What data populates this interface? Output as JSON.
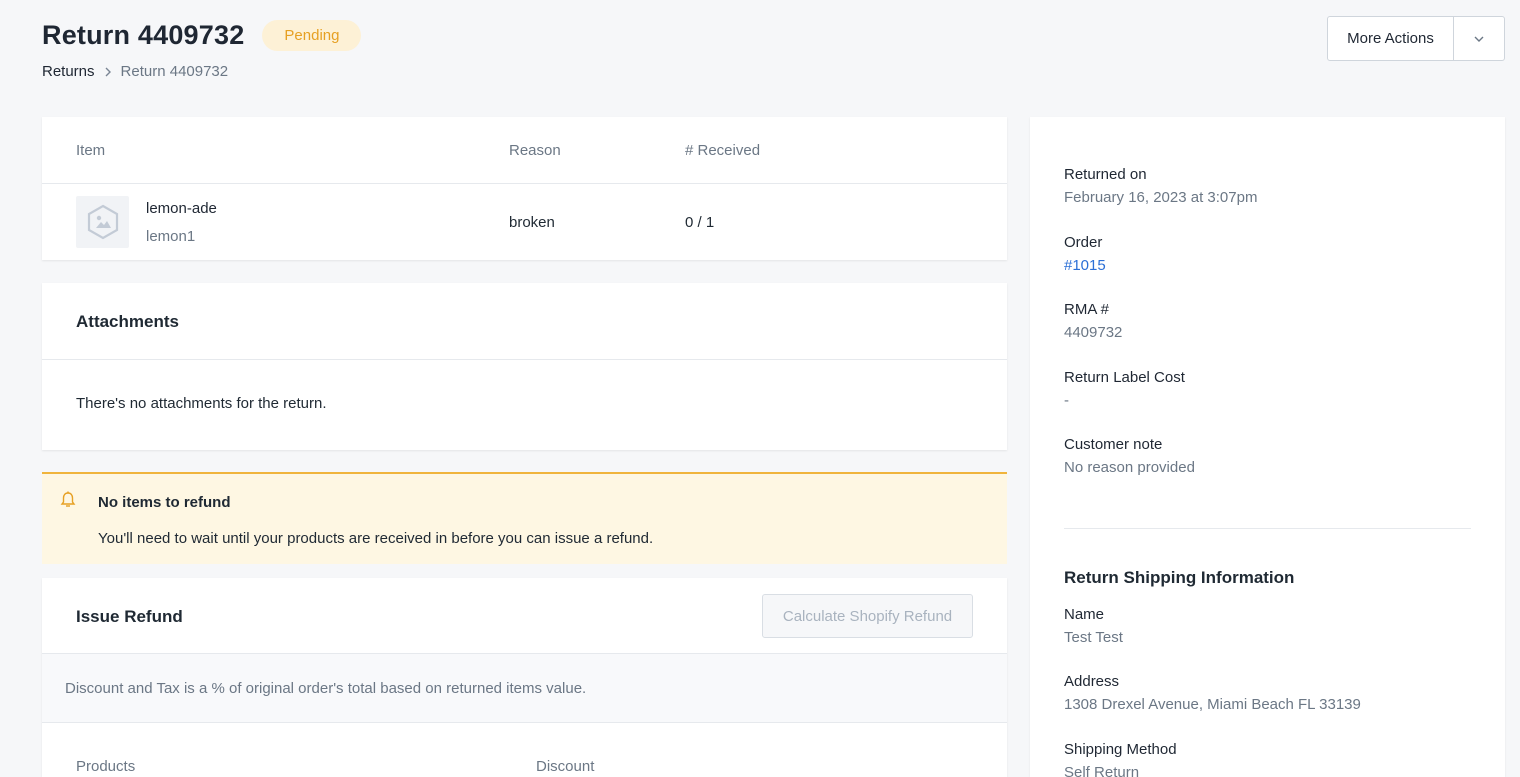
{
  "header": {
    "title": "Return 4409732",
    "status": "Pending",
    "breadcrumb": {
      "parent": "Returns",
      "current": "Return 4409732"
    },
    "more_actions": "More Actions"
  },
  "items": {
    "columns": {
      "item": "Item",
      "reason": "Reason",
      "received": "# Received"
    },
    "rows": [
      {
        "name": "lemon-ade",
        "sku": "lemon1",
        "reason": "broken",
        "received": "0 / 1"
      }
    ]
  },
  "attachments": {
    "title": "Attachments",
    "empty_text": "There's no attachments for the return."
  },
  "alert": {
    "title": "No items to refund",
    "text": "You'll need to wait until your products are received in before you can issue a refund."
  },
  "refund": {
    "title": "Issue Refund",
    "calc_button": "Calculate Shopify Refund",
    "note": "Discount and Tax is a % of original order's total based on returned items value.",
    "columns": {
      "products": "Products",
      "discount": "Discount"
    }
  },
  "details": {
    "returned_on": {
      "label": "Returned on",
      "value": "February 16, 2023 at 3:07pm"
    },
    "order": {
      "label": "Order",
      "value": "#1015"
    },
    "rma": {
      "label": "RMA #",
      "value": "4409732"
    },
    "label_cost": {
      "label": "Return Label Cost",
      "value": "-"
    },
    "customer_note": {
      "label": "Customer note",
      "value": "No reason provided"
    }
  },
  "shipping": {
    "title": "Return Shipping Information",
    "name": {
      "label": "Name",
      "value": "Test Test"
    },
    "address": {
      "label": "Address",
      "value": "1308 Drexel Avenue, Miami Beach FL 33139"
    },
    "method": {
      "label": "Shipping Method",
      "value": "Self Return"
    }
  }
}
